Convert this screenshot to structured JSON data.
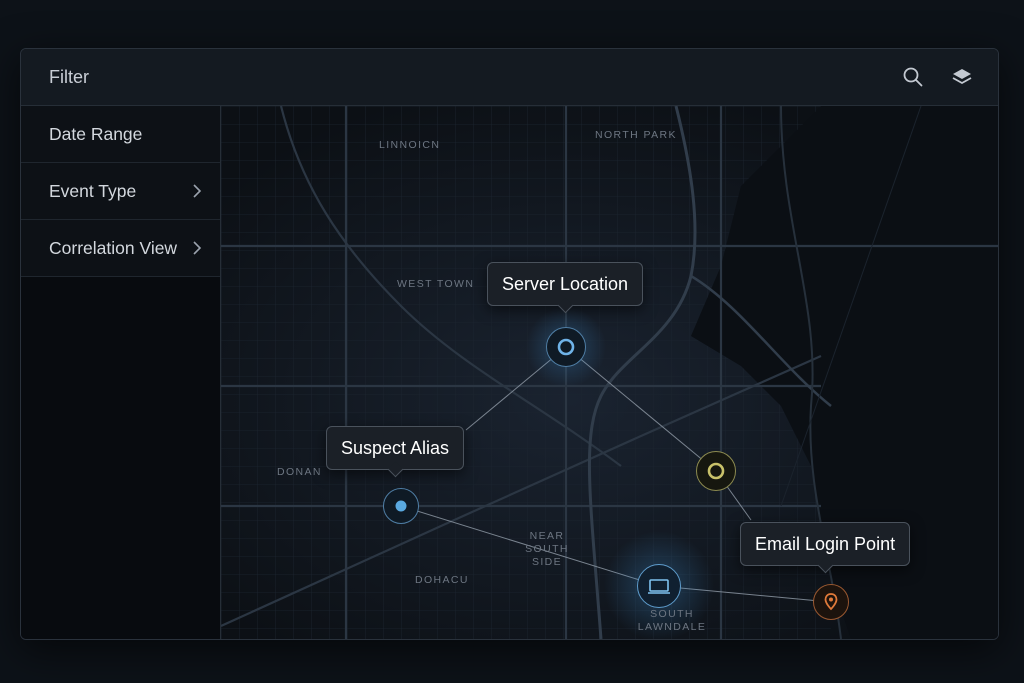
{
  "header": {
    "title": "Filter",
    "icons": [
      "search-icon",
      "layers-icon"
    ]
  },
  "sidebar": {
    "items": [
      {
        "label": "Date Range",
        "has_chevron": false
      },
      {
        "label": "Event Type",
        "has_chevron": true
      },
      {
        "label": "Correlation View",
        "has_chevron": true
      }
    ]
  },
  "map": {
    "districts": [
      "LINNOICN",
      "NORTH PARK",
      "WEST TOWN",
      "DONAN",
      "NEAR SOUTH SIDE",
      "DOHACU",
      "SOUTH LAWNDALE"
    ],
    "callouts": {
      "server": "Server Location",
      "suspect": "Suspect Alias",
      "email": "Email Login Point"
    },
    "nodes": [
      {
        "id": "server",
        "icon": "ring-icon",
        "color": "#6fb3e8"
      },
      {
        "id": "suspect",
        "icon": "dot-icon",
        "color": "#5aa9e0"
      },
      {
        "id": "relay",
        "icon": "ring-icon",
        "color": "#c9c26a"
      },
      {
        "id": "device",
        "icon": "laptop-icon",
        "color": "#7fc3f0"
      },
      {
        "id": "email",
        "icon": "location-pin-icon",
        "color": "#e07a3a"
      }
    ]
  },
  "colors": {
    "background": "#0d1218",
    "panel": "#141a21",
    "accent_blue": "#6fb3e8",
    "accent_yellow": "#c9c26a",
    "accent_orange": "#e07a3a"
  }
}
